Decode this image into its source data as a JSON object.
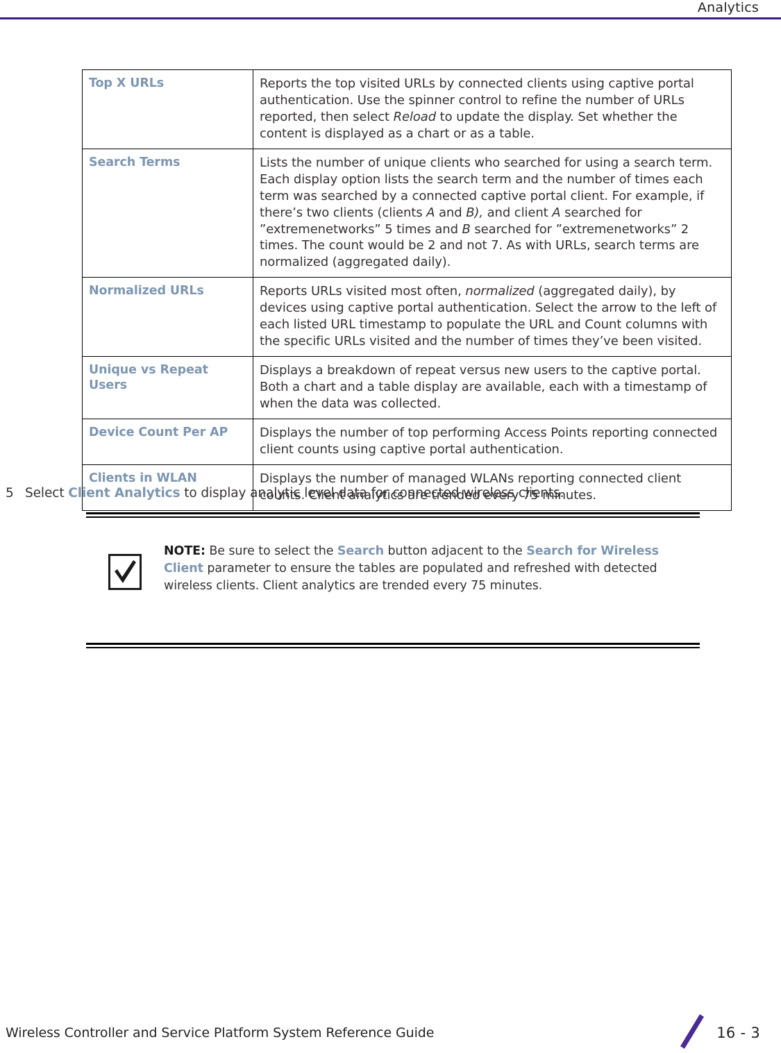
{
  "header": {
    "title": "Analytics",
    "rule_color": "#3b1a8c"
  },
  "table": {
    "rows": [
      {
        "term": "Top X URLs",
        "desc_parts": [
          {
            "text": "Reports the top visited URLs by connected clients using captive portal authentication. Use the spinner control to refine the number of URLs reported, then select ",
            "style": "normal"
          },
          {
            "text": "Reload",
            "style": "italic"
          },
          {
            "text": " to update the display. Set whether the content is displayed as a chart or as a table.",
            "style": "normal"
          }
        ]
      },
      {
        "term": "Search Terms",
        "desc_parts": [
          {
            "text": "Lists the number of unique clients who searched for using a search term. Each display option lists the search term and the number of times each term was searched by a connected captive portal client. For example, if there’s two clients (clients ",
            "style": "normal"
          },
          {
            "text": "A",
            "style": "italic"
          },
          {
            "text": " and ",
            "style": "normal"
          },
          {
            "text": "B),",
            "style": "italic"
          },
          {
            "text": " and client ",
            "style": "normal"
          },
          {
            "text": "A",
            "style": "italic"
          },
          {
            "text": " searched for ”extremenetworks” 5 times and ",
            "style": "normal"
          },
          {
            "text": "B",
            "style": "italic"
          },
          {
            "text": " searched for ”extremenetworks” 2 times. The count would be 2 and not 7. As with URLs, search terms are normalized (aggregated daily).",
            "style": "normal"
          }
        ]
      },
      {
        "term": "Normalized URLs",
        "desc_parts": [
          {
            "text": "Reports URLs visited most often, ",
            "style": "normal"
          },
          {
            "text": "normalized",
            "style": "italic"
          },
          {
            "text": " (aggregated daily), by devices using captive portal authentication. Select the arrow to the left of each listed URL timestamp to populate the URL and Count columns with the specific URLs visited and the number of times they’ve been visited.",
            "style": "normal"
          }
        ]
      },
      {
        "term": "Unique vs Repeat Users",
        "desc_parts": [
          {
            "text": "Displays a breakdown of repeat versus new users to the captive portal. Both a chart and a table display are available, each with a timestamp of when the data was collected.",
            "style": "normal"
          }
        ]
      },
      {
        "term": "Device Count Per AP",
        "desc_parts": [
          {
            "text": "Displays the number of top performing Access Points reporting connected client counts using captive portal authentication.",
            "style": "normal"
          }
        ]
      },
      {
        "term": "Clients in WLAN",
        "desc_parts": [
          {
            "text": "Displays the number of managed WLANs reporting connected client counts. Client analytics are trended every 75 minutes.",
            "style": "normal"
          }
        ]
      }
    ]
  },
  "step": {
    "number": "5",
    "parts": [
      {
        "text": "Select ",
        "style": "normal"
      },
      {
        "text": "Client Analytics",
        "style": "term"
      },
      {
        "text": " to display analytic level data for connected wireless clients.",
        "style": "normal"
      }
    ]
  },
  "note": {
    "icon": "checkmark-icon",
    "label": "NOTE:",
    "parts": [
      {
        "text": " Be sure to select the ",
        "style": "normal"
      },
      {
        "text": "Search",
        "style": "term"
      },
      {
        "text": " button adjacent to the ",
        "style": "normal"
      },
      {
        "text": "Search for Wireless Client",
        "style": "term"
      },
      {
        "text": " parameter to ensure the tables are populated and refreshed with detected wireless clients. Client analytics are trended every 75 minutes.",
        "style": "normal"
      }
    ]
  },
  "footer": {
    "title": "Wireless Controller and Service Platform System Reference Guide",
    "page": "16 - 3",
    "slash_color": "#4b2a96"
  },
  "colors": {
    "term_blue": "#7d96b0",
    "body_text": "#353132",
    "rule_purple": "#3b1a8c"
  }
}
